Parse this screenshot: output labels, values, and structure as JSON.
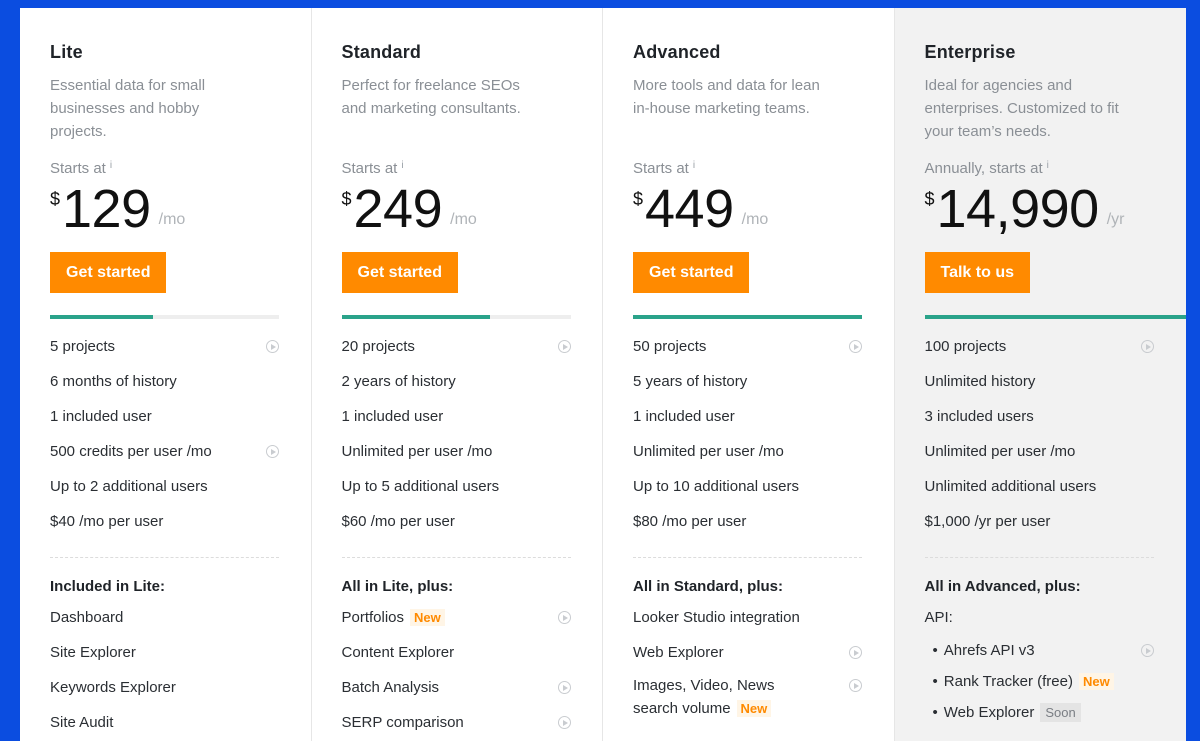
{
  "plans": [
    {
      "name": "Lite",
      "desc": "Essential data for small businesses and hobby projects.",
      "starts": "Starts at",
      "currency": "$",
      "price": "129",
      "period": "/mo",
      "cta": "Get started",
      "meter": 0.45,
      "limits": [
        "5 projects",
        "6 months of history",
        "1 included user",
        "500 credits per user /mo",
        "Up to 2 additional users",
        "$40 /mo per user"
      ],
      "included_title": "Included in Lite:",
      "features": [
        "Dashboard",
        "Site Explorer",
        "Keywords Explorer",
        "Site Audit"
      ]
    },
    {
      "name": "Standard",
      "desc": "Perfect for freelance SEOs and marketing consultants.",
      "starts": "Starts at",
      "currency": "$",
      "price": "249",
      "period": "/mo",
      "cta": "Get started",
      "meter": 0.65,
      "limits": [
        "20 projects",
        "2 years of history",
        "1 included user",
        "Unlimited per user /mo",
        "Up to 5 additional users",
        "$60 /mo per user"
      ],
      "included_title": "All in Lite, plus:",
      "features": [
        "Portfolios",
        "Content Explorer",
        "Batch Analysis",
        "SERP comparison"
      ],
      "badge_new": "New"
    },
    {
      "name": "Advanced",
      "desc": "More tools and data for lean in-house marketing teams.",
      "starts": "Starts at",
      "currency": "$",
      "price": "449",
      "period": "/mo",
      "cta": "Get started",
      "meter": 1.0,
      "limits": [
        "50 projects",
        "5 years of history",
        "1 included user",
        "Unlimited per user /mo",
        "Up to 10 additional users",
        "$80 /mo per user"
      ],
      "included_title": "All in Standard, plus:",
      "features": [
        "Looker Studio integration",
        "Web Explorer",
        "Images, Video, News search volume"
      ],
      "badge_new": "New"
    },
    {
      "name": "Enterprise",
      "desc": "Ideal for agencies and enterprises. Customized to fit your team’s needs.",
      "starts": "Annually, starts at",
      "currency": "$",
      "price": "14,990",
      "period": "/yr",
      "cta": "Talk to us",
      "meter": 1.0,
      "limits": [
        "100 projects",
        "Unlimited history",
        "3 included users",
        "Unlimited per user /mo",
        "Unlimited additional users",
        "$1,000 /yr per user"
      ],
      "included_title": "All in Advanced, plus:",
      "features": [
        "API:",
        "Ahrefs API v3",
        "Rank Tracker (free)",
        "Web Explorer"
      ],
      "badge_new": "New",
      "badge_soon": "Soon"
    }
  ],
  "info_glyph": "i",
  "bullet_glyph": "•",
  "icons": {
    "play": "play-circle-icon",
    "info": "info-icon"
  }
}
